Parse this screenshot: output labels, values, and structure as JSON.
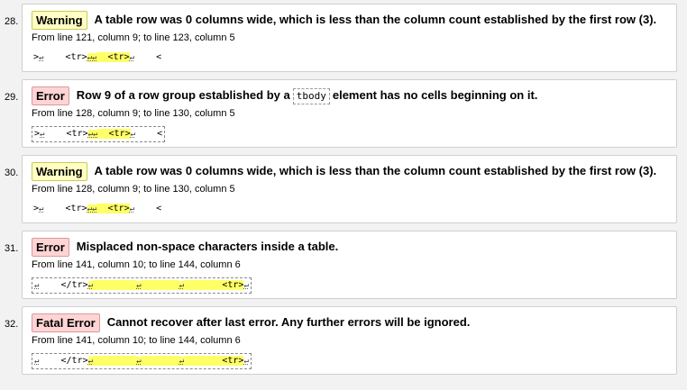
{
  "messages": [
    {
      "num": "28.",
      "type": "Warning",
      "kind": "warning",
      "text": "A table row was 0 columns wide, which is less than the column count established by the first row (3).",
      "location": "From line 121, column 9; to line 123, column 5",
      "extract": [
        {
          "t": ">"
        },
        {
          "t": "↵",
          "lb": true
        },
        {
          "t": "    <tr>"
        },
        {
          "t": "↵↵",
          "hl": true,
          "lb": true
        },
        {
          "t": "  ",
          "hl": true
        },
        {
          "t": "<tr>",
          "hl": true
        },
        {
          "t": "↵",
          "lb": true
        },
        {
          "t": "    <"
        }
      ],
      "boxed": false
    },
    {
      "num": "29.",
      "type": "Error",
      "kind": "error",
      "text_before": "Row 9 of a row group established by a",
      "code": "tbody",
      "text_after": "element has no cells beginning on it.",
      "location": "From line 128, column 9; to line 130, column 5",
      "extract": [
        {
          "t": ">"
        },
        {
          "t": "↵",
          "lb": true
        },
        {
          "t": "    <tr>"
        },
        {
          "t": "↵↵",
          "hl": true,
          "lb": true
        },
        {
          "t": "  ",
          "hl": true
        },
        {
          "t": "<tr>",
          "hl": true
        },
        {
          "t": "↵",
          "lb": true
        },
        {
          "t": "    <"
        }
      ],
      "boxed": true
    },
    {
      "num": "30.",
      "type": "Warning",
      "kind": "warning",
      "text": "A table row was 0 columns wide, which is less than the column count established by the first row (3).",
      "location": "From line 128, column 9; to line 130, column 5",
      "extract": [
        {
          "t": ">"
        },
        {
          "t": "↵",
          "lb": true
        },
        {
          "t": "    <tr>"
        },
        {
          "t": "↵↵",
          "hl": true,
          "lb": true
        },
        {
          "t": "  ",
          "hl": true
        },
        {
          "t": "<tr>",
          "hl": true
        },
        {
          "t": "↵",
          "lb": true
        },
        {
          "t": "    <"
        }
      ],
      "boxed": false
    },
    {
      "num": "31.",
      "type": "Error",
      "kind": "error",
      "text": "Misplaced non-space characters inside a table.",
      "location": "From line 141, column 10; to line 144, column 6",
      "extract": [
        {
          "t": "↵",
          "lb": true
        },
        {
          "t": "    </tr>"
        },
        {
          "t": "↵",
          "hl": true,
          "lb": true
        },
        {
          "t": "        ",
          "hl": true
        },
        {
          "t": "↵",
          "hl": true,
          "lb": true
        },
        {
          "t": "       ",
          "hl": true
        },
        {
          "t": "↵",
          "hl": true,
          "lb": true
        },
        {
          "t": "       ",
          "hl": true
        },
        {
          "t": "<tr>",
          "hl": true
        },
        {
          "t": "↵",
          "lb": true
        }
      ],
      "boxed": true
    },
    {
      "num": "32.",
      "type": "Fatal Error",
      "kind": "fatal",
      "text": "Cannot recover after last error. Any further errors will be ignored.",
      "location": "From line 141, column 10; to line 144, column 6",
      "extract": [
        {
          "t": "↵",
          "lb": true
        },
        {
          "t": "    </tr>"
        },
        {
          "t": "↵",
          "hl": true,
          "lb": true
        },
        {
          "t": "        ",
          "hl": true
        },
        {
          "t": "↵",
          "hl": true,
          "lb": true
        },
        {
          "t": "       ",
          "hl": true
        },
        {
          "t": "↵",
          "hl": true,
          "lb": true
        },
        {
          "t": "       ",
          "hl": true
        },
        {
          "t": "<tr>",
          "hl": true
        },
        {
          "t": "↵",
          "lb": true
        }
      ],
      "boxed": true
    }
  ]
}
